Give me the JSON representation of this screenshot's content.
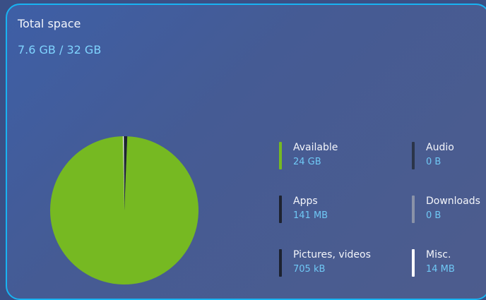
{
  "storage": {
    "title": "Total space",
    "usage": "7.6 GB / 32 GB"
  },
  "colors": {
    "available": "#76b922",
    "apps": "#1e2330",
    "pictures": "#1c2230",
    "audio": "#2b3549",
    "downloads": "#8a93a8",
    "misc": "#ffffff",
    "accent_text": "#7fd4ff",
    "border": "#18b3f2"
  },
  "legend": [
    {
      "label": "Available",
      "value": "24 GB",
      "color": "#76b922"
    },
    {
      "label": "Apps",
      "value": "141 MB",
      "color": "#1e2330"
    },
    {
      "label": "Pictures, videos",
      "value": "705 kB",
      "color": "#1c2230"
    },
    {
      "label": "Audio",
      "value": "0 B",
      "color": "#2b3549"
    },
    {
      "label": "Downloads",
      "value": "0 B",
      "color": "#8a93a8"
    },
    {
      "label": "Misc.",
      "value": "14 MB",
      "color": "#ffffff"
    }
  ],
  "chart_data": {
    "type": "pie",
    "slices": [
      {
        "name": "Available",
        "value": 24576,
        "unit": "MB",
        "color": "#76b922"
      },
      {
        "name": "Apps",
        "value": 141,
        "unit": "MB",
        "color": "#1e2330"
      },
      {
        "name": "Pictures, videos",
        "value": 0.705,
        "unit": "MB",
        "color": "#1c2230"
      },
      {
        "name": "Audio",
        "value": 0,
        "unit": "MB",
        "color": "#2b3549"
      },
      {
        "name": "Downloads",
        "value": 0,
        "unit": "MB",
        "color": "#8a93a8"
      },
      {
        "name": "Misc.",
        "value": 14,
        "unit": "MB",
        "color": "#ffffff"
      }
    ]
  }
}
